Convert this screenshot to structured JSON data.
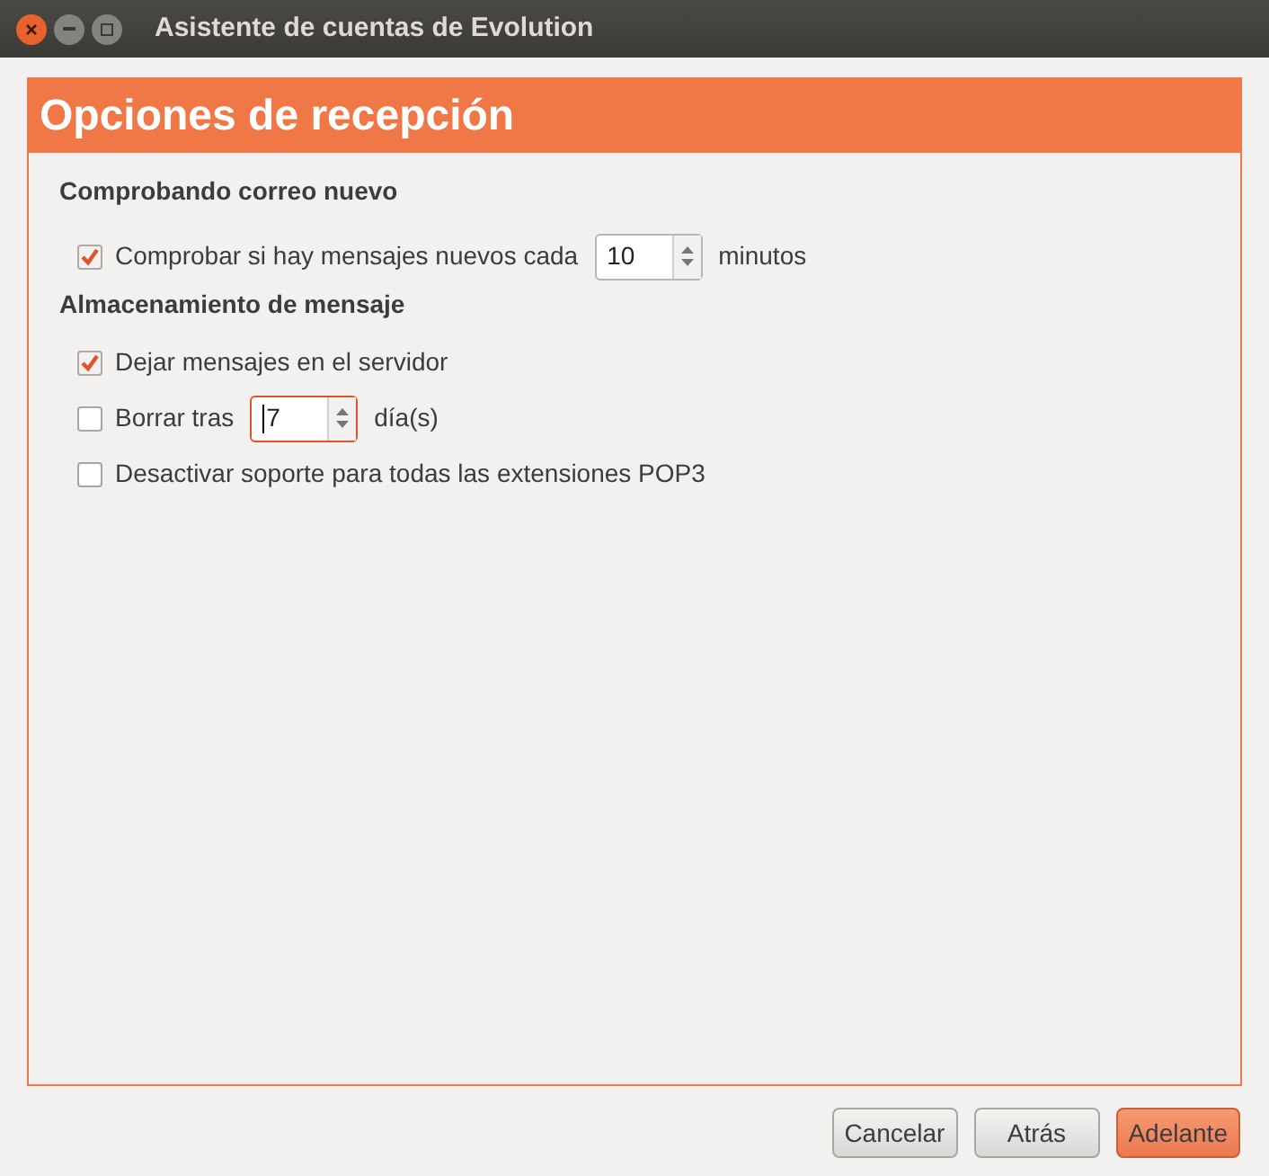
{
  "window": {
    "title": "Asistente de cuentas de Evolution"
  },
  "page_title": "Opciones de recepción",
  "sections": [
    {
      "title": "Comprobando correo nuevo",
      "options": [
        {
          "kind": "spin",
          "label": "Comprobar si hay mensajes nuevos cada",
          "checked": true,
          "value": "10",
          "focused": false,
          "unit": "minutos"
        }
      ]
    },
    {
      "title": "Almacenamiento de mensaje",
      "options": [
        {
          "kind": "check",
          "label": "Dejar mensajes en el servidor",
          "checked": true
        },
        {
          "kind": "spin",
          "label": "Borrar tras",
          "checked": false,
          "value": "7",
          "focused": true,
          "unit": "día(s)"
        },
        {
          "kind": "check",
          "label": "Desactivar soporte para todas las extensiones POP3",
          "checked": false
        }
      ]
    }
  ],
  "buttons": [
    {
      "label": "Cancelar",
      "kind": "normal"
    },
    {
      "label": "Atrás",
      "kind": "normal"
    },
    {
      "label": "Adelante",
      "kind": "suggested"
    }
  ]
}
